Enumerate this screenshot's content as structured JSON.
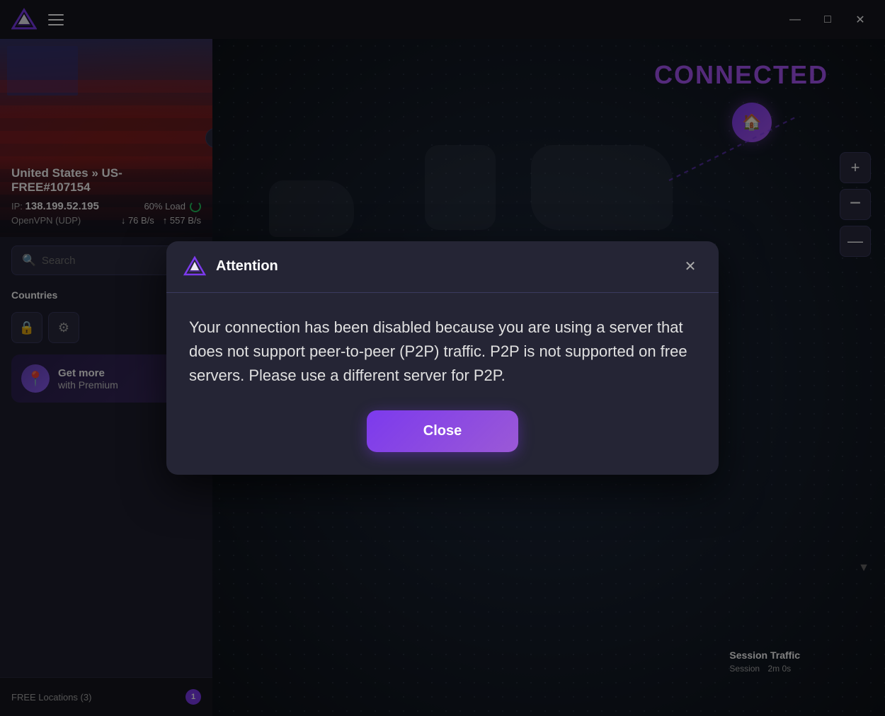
{
  "titleBar": {
    "minimizeLabel": "—",
    "maximizeLabel": "□",
    "closeLabel": "✕"
  },
  "serverHeader": {
    "serverName": "United States » US-FREE#107154",
    "ipLabel": "IP:",
    "ipValue": "138.199.52.195",
    "loadLabel": "60% Load",
    "protocol": "OpenVPN (UDP)",
    "downloadSpeed": "↓ 76 B/s",
    "uploadSpeed": "↑ 557 B/s",
    "collapseIcon": "‹"
  },
  "searchArea": {
    "placeholder": "Search",
    "searchIcon": "🔍"
  },
  "tabs": {
    "countries": "Countries"
  },
  "filterButtons": [
    {
      "icon": "🔒",
      "label": "secure-filter"
    },
    {
      "icon": "⚙",
      "label": "settings-filter"
    }
  ],
  "getMore": {
    "title": "Get more",
    "subtitle": "with Premium",
    "icon": "📍"
  },
  "bottomBar": {
    "freeLocations": "FREE Locations (3)",
    "sessionBadge": "1",
    "sessionTrafficLabel": "Session Traffic",
    "sessionLabel": "Session",
    "sessionTime": "2m 0s"
  },
  "mapPanel": {
    "connectedLabel": "CONNECTED",
    "homeIcon": "🏠",
    "zoomIn": "+",
    "zoomOut": "−",
    "zoomOutAlt": "—"
  },
  "dialog": {
    "title": "Attention",
    "closeIcon": "✕",
    "message": "Your connection has been disabled because you are using a server that does not support peer-to-peer (P2P) traffic. P2P is not supported on free servers. Please use a different server for P2P.",
    "closeButton": "Close"
  }
}
